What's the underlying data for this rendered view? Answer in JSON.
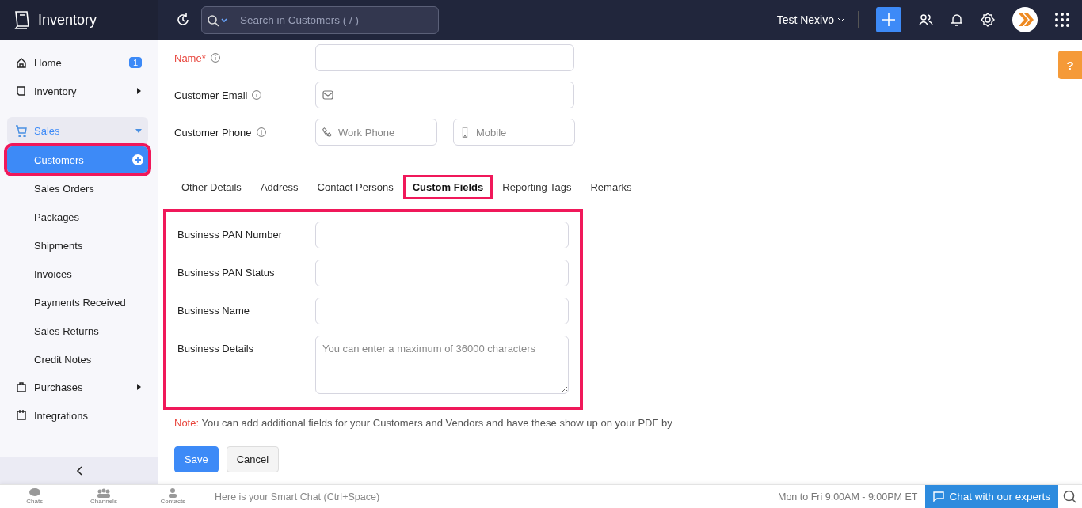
{
  "app": {
    "title": "Inventory"
  },
  "search": {
    "placeholder": "Search in Customers ( / )"
  },
  "org": {
    "name": "Test Nexivo"
  },
  "sidebar": {
    "items": [
      {
        "label": "Home",
        "kind": "link",
        "badge": "1"
      },
      {
        "label": "Inventory",
        "kind": "group",
        "expanded": false
      },
      {
        "label": "Sales",
        "kind": "group",
        "expanded": true,
        "children": [
          {
            "label": "Customers",
            "selected": true,
            "highlighted": true
          },
          {
            "label": "Sales Orders",
            "selected": false,
            "highlighted": false
          },
          {
            "label": "Packages",
            "selected": false,
            "highlighted": false
          },
          {
            "label": "Shipments",
            "selected": false,
            "highlighted": false
          },
          {
            "label": "Invoices",
            "selected": false,
            "highlighted": false
          },
          {
            "label": "Payments Received",
            "selected": false,
            "highlighted": false
          },
          {
            "label": "Sales Returns",
            "selected": false,
            "highlighted": false
          },
          {
            "label": "Credit Notes",
            "selected": false,
            "highlighted": false
          }
        ]
      },
      {
        "label": "Purchases",
        "kind": "group",
        "expanded": false
      },
      {
        "label": "Integrations",
        "kind": "link"
      }
    ]
  },
  "form": {
    "rows": [
      {
        "label": "Name*",
        "required": true,
        "kind": "select",
        "fields": []
      },
      {
        "label": "Customer Email",
        "required": false,
        "kind": "email",
        "fields": []
      },
      {
        "label": "Customer Phone",
        "required": false,
        "kind": "phone",
        "fields": [
          {
            "placeholder": "Work Phone"
          },
          {
            "placeholder": "Mobile"
          }
        ]
      }
    ]
  },
  "tabs": [
    {
      "label": "Other Details",
      "selected": false,
      "highlighted": false
    },
    {
      "label": "Address",
      "selected": false,
      "highlighted": false
    },
    {
      "label": "Contact Persons",
      "selected": false,
      "highlighted": false
    },
    {
      "label": "Custom Fields",
      "selected": true,
      "highlighted": true
    },
    {
      "label": "Reporting Tags",
      "selected": false,
      "highlighted": false
    },
    {
      "label": "Remarks",
      "selected": false,
      "highlighted": false
    }
  ],
  "custom_fields": {
    "highlighted": true,
    "fields": [
      {
        "label": "Business PAN Number",
        "kind": "text"
      },
      {
        "label": "Business PAN Status",
        "kind": "text"
      },
      {
        "label": "Business Name",
        "kind": "text"
      },
      {
        "label": "Business Details",
        "kind": "textarea",
        "placeholder": "You can enter a maximum of 36000 characters"
      }
    ]
  },
  "note": {
    "label": "Note:",
    "text": "You can add additional fields for your Customers and Vendors and have these show up on your PDF by"
  },
  "actions": [
    {
      "label": "Save",
      "primary": true
    },
    {
      "label": "Cancel",
      "primary": false
    }
  ],
  "footer": {
    "tabs": [
      "Chats",
      "Channels",
      "Contacts"
    ],
    "chat_placeholder": "Here is your Smart Chat (Ctrl+Space)",
    "hours": "Mon to Fri 9:00AM - 9:00PM ET",
    "chat_button": "Chat with our experts"
  },
  "help": {
    "label": "?"
  }
}
